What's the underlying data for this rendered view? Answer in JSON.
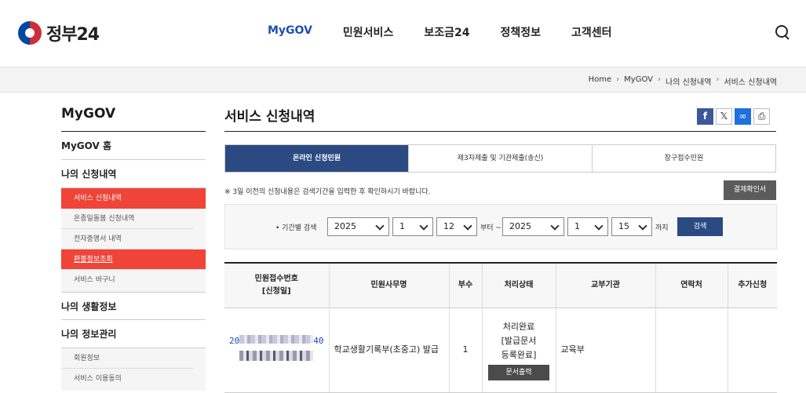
{
  "header": {
    "logo_text": "정부24",
    "nav": [
      "MyGOV",
      "민원서비스",
      "보조금24",
      "정책정보",
      "고객센터"
    ]
  },
  "breadcrumb": [
    "Home",
    "MyGOV",
    "나의 신청내역",
    "서비스 신청내역"
  ],
  "sidebar": {
    "title": "MyGOV",
    "home": "MyGOV 홈",
    "applications": "나의 신청내역",
    "application_items": [
      "서비스 신청내역",
      "온종일돌봄 신청내역",
      "전자증명서 내역",
      "환불정보조회",
      "서비스 바구니"
    ],
    "life": "나의 생활정보",
    "info": "나의 정보관리",
    "info_items": [
      "회원정보",
      "서비스 이용동의"
    ]
  },
  "main": {
    "title": "서비스 신청내역",
    "tabs": [
      "온라인 신청민원",
      "제3자제출 및 기관제출(송신)",
      "창구접수민원"
    ],
    "notice": "※ 3일 이전의 신청내용은 검색기간을 입력한 후 확인하시기 바랍니다.",
    "confirm_button": "결제확인서",
    "filter": {
      "label": "• 기간별 검색",
      "from_year": "2025",
      "from_month": "1",
      "from_day": "12",
      "from_text": "부터 ~",
      "to_year": "2025",
      "to_month": "1",
      "to_day": "15",
      "to_text": "까지",
      "search_button": "검색"
    },
    "table": {
      "headers": [
        "민원접수번호\n[신청일]",
        "민원사무명",
        "부수",
        "처리상태",
        "교부기관",
        "연락처",
        "추가신청"
      ],
      "header1_line1": "민원접수번호",
      "header1_line2": "[신청일]",
      "row": {
        "receipt_prefix": "20",
        "receipt_suffix": "40",
        "service_name": "학교생활기록부(초중고) 발급",
        "copies": "1",
        "status_line1": "처리완료",
        "status_line2": "[발급문서",
        "status_line3": "등록완료]",
        "print_button": "문서출력",
        "agency": "교육부",
        "contact": "",
        "additional": ""
      }
    }
  }
}
